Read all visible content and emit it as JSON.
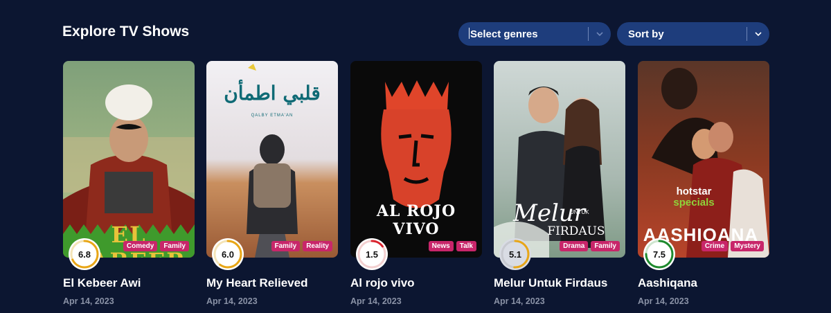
{
  "header": {
    "title": "Explore TV Shows",
    "genres_select": {
      "value": "Select genres"
    },
    "sort_select": {
      "value": "Sort by"
    }
  },
  "colors": {
    "background": "#0c1631",
    "select_bg": "#1e3d7c",
    "badge_bg": "#c8266a",
    "rating_yellow": "#e8a617",
    "rating_red": "#d9232e",
    "rating_green": "#1f8a2e"
  },
  "shows": [
    {
      "title": "El Kebeer Awi",
      "date": "Apr 14, 2023",
      "rating": "6.8",
      "rating_fraction": 0.68,
      "ring_color": "#e8a617",
      "genres": [
        "Comedy",
        "Family"
      ],
      "poster_text": "EL KABEER"
    },
    {
      "title": "My Heart Relieved",
      "date": "Apr 14, 2023",
      "rating": "6.0",
      "rating_fraction": 0.6,
      "ring_color": "#e8a617",
      "genres": [
        "Family",
        "Reality"
      ],
      "poster_text": "قلبي اطمأن",
      "poster_subtext": "QALBY ETMA'AN"
    },
    {
      "title": "Al rojo vivo",
      "date": "Apr 14, 2023",
      "rating": "1.5",
      "rating_fraction": 0.15,
      "ring_color": "#d9232e",
      "genres": [
        "News",
        "Talk"
      ],
      "poster_text": "AL ROJO VIVO"
    },
    {
      "title": "Melur Untuk Firdaus",
      "date": "Apr 14, 2023",
      "rating": "5.1",
      "rating_fraction": 0.51,
      "ring_color": "#e8a617",
      "genres": [
        "Drama",
        "Family"
      ],
      "poster_text": "Melur",
      "poster_subtext_a": "UNTUK",
      "poster_subtext_b": "FIRDAUS"
    },
    {
      "title": "Aashiqana",
      "date": "Apr 14, 2023",
      "rating": "7.5",
      "rating_fraction": 0.75,
      "ring_color": "#1f8a2e",
      "genres": [
        "Crime",
        "Mystery"
      ],
      "poster_text": "AASHIQANA",
      "poster_subtext_a": "hotstar",
      "poster_subtext_b": "specials"
    }
  ]
}
